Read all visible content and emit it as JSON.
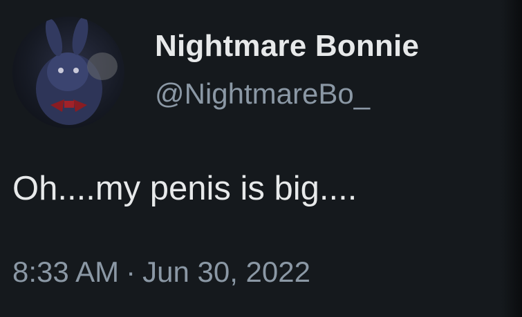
{
  "tweet": {
    "display_name": "Nightmare Bonnie",
    "handle": "@NightmareBo_",
    "text": "Oh....my penis is big....",
    "time": "8:33 AM",
    "separator": "·",
    "date": "Jun 30, 2022"
  },
  "colors": {
    "background": "#15191d",
    "primary_text": "#e7e9ea",
    "secondary_text": "#8b98a5"
  }
}
